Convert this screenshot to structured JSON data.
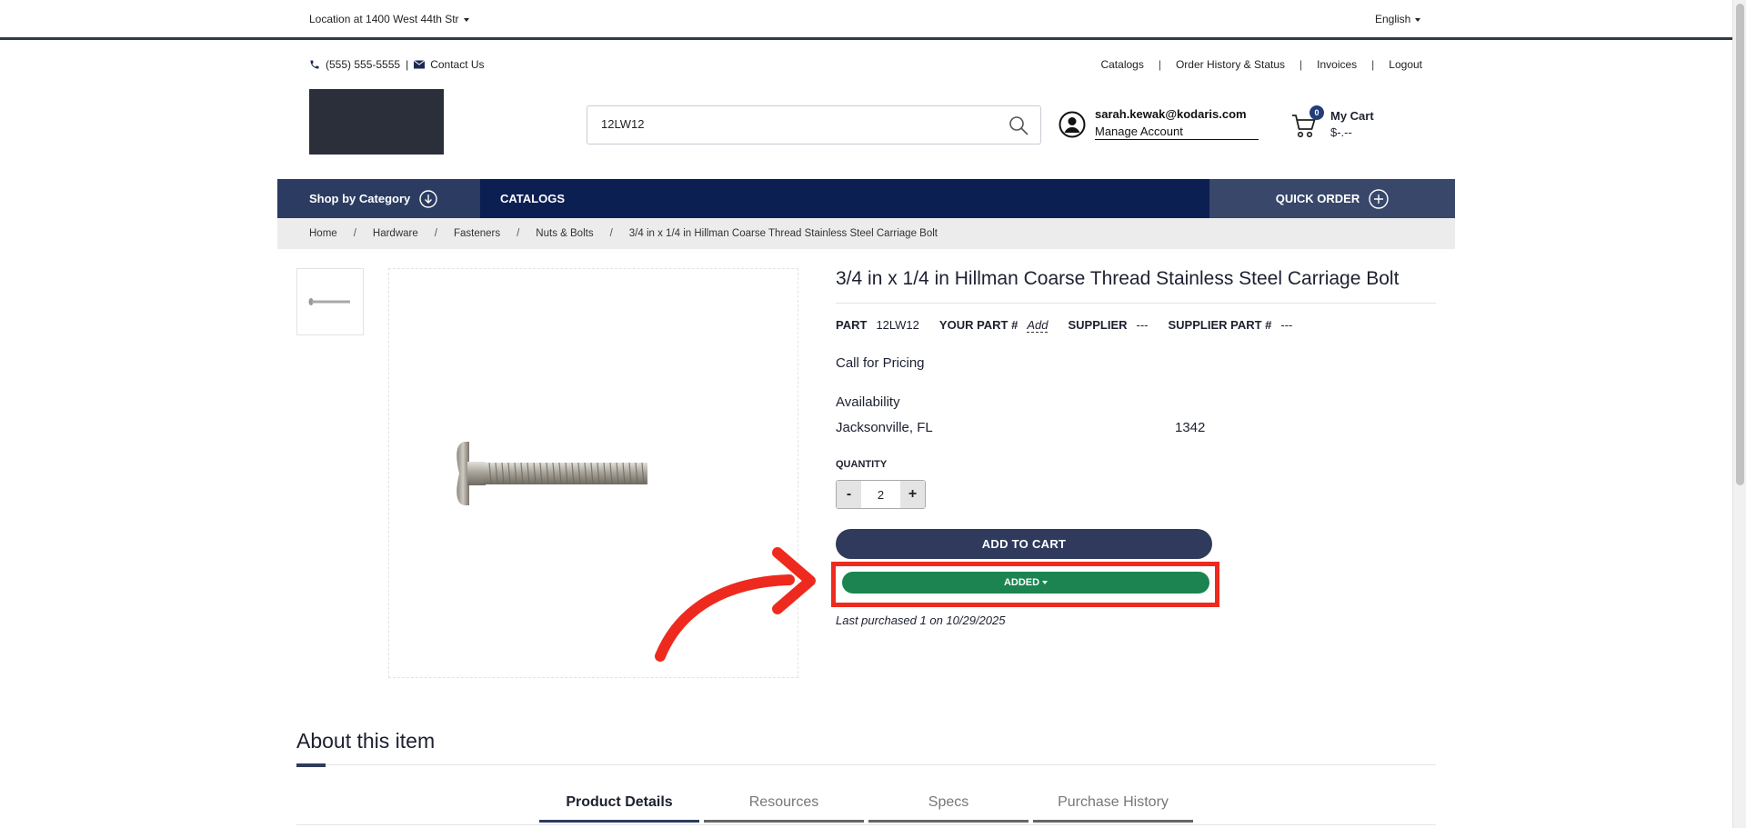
{
  "topbar": {
    "location": "Location at 1400 West 44th Str",
    "language": "English"
  },
  "header": {
    "phone": "(555) 555-5555",
    "contact": "Contact Us",
    "links": [
      "Catalogs",
      "Order History & Status",
      "Invoices",
      "Logout"
    ],
    "search_value": "12LW12",
    "account_email": "sarah.kewak@kodaris.com",
    "manage_account": "Manage Account",
    "cart_count": "0",
    "cart_label": "My Cart",
    "cart_total": "$-.--"
  },
  "nav": {
    "shop_by_category": "Shop by Category",
    "catalogs": "CATALOGS",
    "quick_order": "QUICK ORDER"
  },
  "breadcrumb": [
    "Home",
    "Hardware",
    "Fasteners",
    "Nuts & Bolts",
    "3/4 in x 1/4 in Hillman Coarse Thread Stainless Steel Carriage Bolt"
  ],
  "product": {
    "title": "3/4 in x 1/4 in Hillman Coarse Thread Stainless Steel Carriage Bolt",
    "part_label": "PART",
    "part_value": "12LW12",
    "your_part_label": "YOUR PART #",
    "your_part_value": "Add",
    "supplier_label": "SUPPLIER",
    "supplier_value": "---",
    "supplier_part_label": "SUPPLIER PART #",
    "supplier_part_value": "---",
    "pricing": "Call for Pricing",
    "availability_heading": "Availability",
    "availability_location": "Jacksonville, FL",
    "availability_qty": "1342",
    "quantity_label": "QUANTITY",
    "quantity_value": "2",
    "minus": "-",
    "plus": "+",
    "add_to_cart": "ADD TO CART",
    "added": "ADDED",
    "last_purchased": "Last purchased 1 on 10/29/2025"
  },
  "about": {
    "heading": "About this item",
    "tabs": [
      "Product Details",
      "Resources",
      "Specs",
      "Purchase History"
    ]
  },
  "colors": {
    "nav_bg": "#0c1f53",
    "added_green": "#1b8450",
    "highlight_red": "#ee2a1e",
    "button_navy": "#2f3a5c"
  }
}
